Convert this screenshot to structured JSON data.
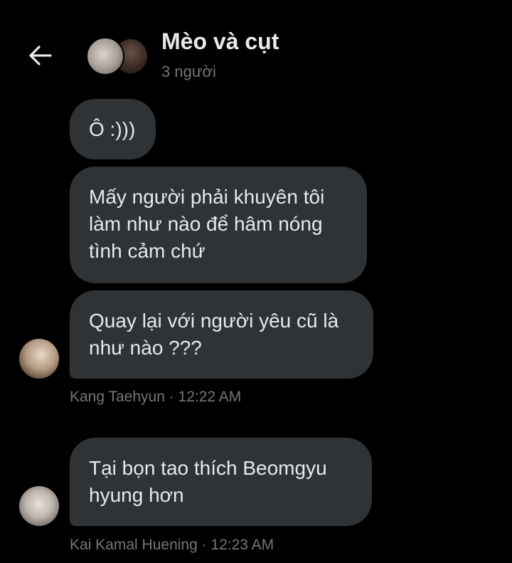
{
  "header": {
    "back_icon": "arrow-left-icon",
    "title": "Mèo và cụt",
    "subtitle": "3 người"
  },
  "messages": [
    {
      "text": "Ô :)))"
    },
    {
      "text": "Mấy người phải khuyên tôi\nlàm như nào để hâm nóng\ntình cảm chứ"
    },
    {
      "text": "Quay lại với người yêu cũ là\nnhư nào ???"
    },
    {
      "text": "Tại bọn tao thích Beomgyu\nhyung hơn"
    }
  ],
  "meta": [
    {
      "text": "Kang Taehyun · 12:22 AM"
    },
    {
      "text": "Kai Kamal Huening · 12:23 AM"
    }
  ],
  "colors": {
    "background": "#000000",
    "bubble": "#2f3336",
    "text": "#e7e9ea",
    "secondary_text": "#71767b"
  }
}
